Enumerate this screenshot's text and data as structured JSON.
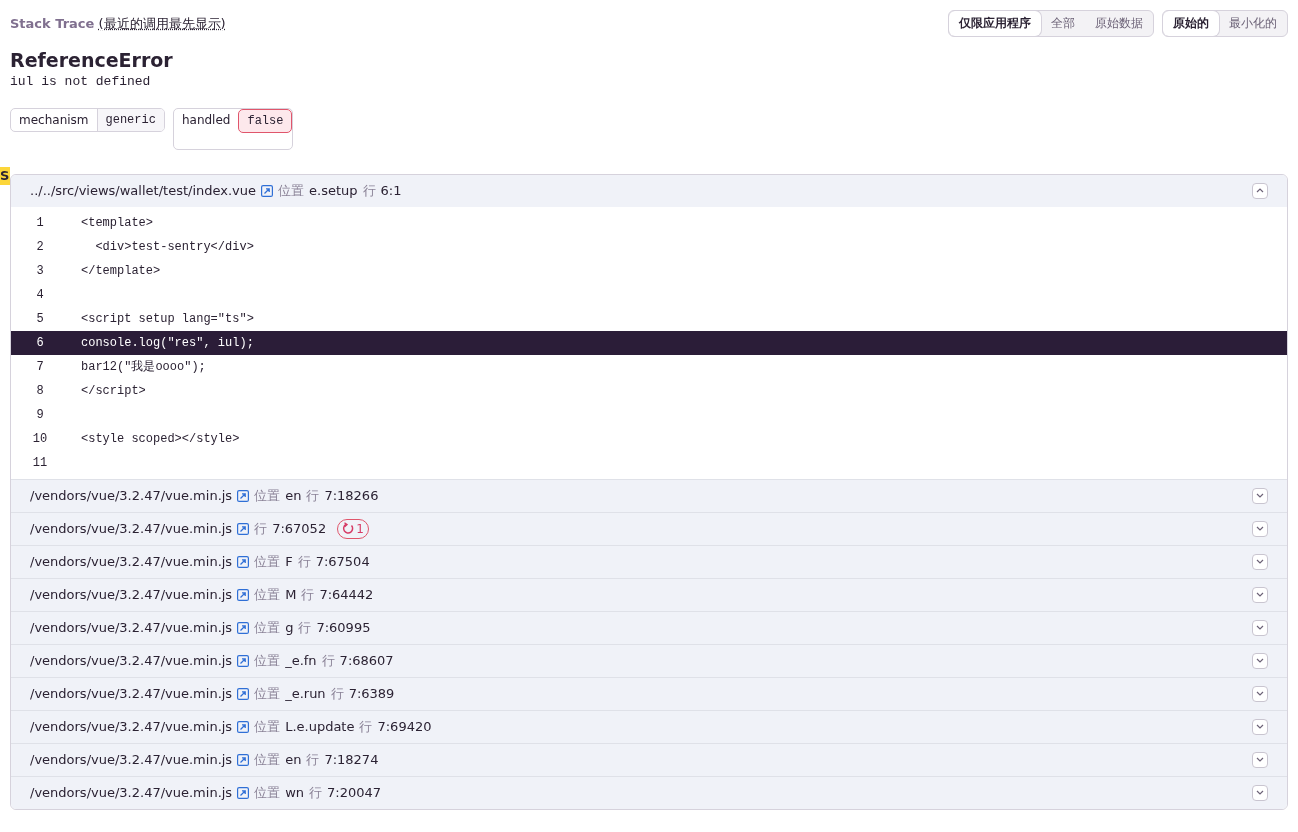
{
  "header": {
    "title": "Stack Trace",
    "subtitle": "(最近的调用最先显示)"
  },
  "filters": [
    [
      {
        "label": "仅限应用程序",
        "selected": true
      },
      {
        "label": "全部",
        "selected": false
      },
      {
        "label": "原始数据",
        "selected": false
      }
    ],
    [
      {
        "label": "原始的",
        "selected": true
      },
      {
        "label": "最小化的",
        "selected": false
      }
    ]
  ],
  "error": {
    "type": "ReferenceError",
    "message": "iul is not defined"
  },
  "tags": [
    {
      "key": "mechanism",
      "value": "generic",
      "alert": false
    },
    {
      "key": "handled",
      "value": "false",
      "alert": true
    }
  ],
  "side_marker": "S",
  "frames": [
    {
      "file": "../../src/views/wallet/test/index.vue",
      "at_label": "位置",
      "function": "e.setup",
      "line_label": "行",
      "line": "6:1",
      "expanded": true,
      "code": [
        {
          "number": "1",
          "text": "<template>",
          "selected": false
        },
        {
          "number": "2",
          "text": "  <div>test-sentry</div>",
          "selected": false
        },
        {
          "number": "3",
          "text": "</template>",
          "selected": false
        },
        {
          "number": "4",
          "selected": false
        },
        {
          "number": "5",
          "text": "<script setup lang=\"ts\">",
          "selected": false
        },
        {
          "number": "6",
          "text": "console.log(\"res\", iul);",
          "selected": true
        },
        {
          "number": "7",
          "text": "bar12(\"我是oooo\");",
          "selected": false
        },
        {
          "number": "8",
          "text": "</script>",
          "selected": false
        },
        {
          "number": "9",
          "selected": false
        },
        {
          "number": "10",
          "text": "<style scoped></style>",
          "selected": false
        },
        {
          "number": "11",
          "selected": false
        }
      ]
    },
    {
      "file": "/vendors/vue/3.2.47/vue.min.js",
      "at_label": "位置",
      "function": "en",
      "line_label": "行",
      "line": "7:18266",
      "expanded": false
    },
    {
      "file": "/vendors/vue/3.2.47/vue.min.js",
      "line_label": "行",
      "line": "7:67052",
      "repeats": "1",
      "expanded": false
    },
    {
      "file": "/vendors/vue/3.2.47/vue.min.js",
      "at_label": "位置",
      "function": "F",
      "line_label": "行",
      "line": "7:67504",
      "expanded": false
    },
    {
      "file": "/vendors/vue/3.2.47/vue.min.js",
      "at_label": "位置",
      "function": "M",
      "line_label": "行",
      "line": "7:64442",
      "expanded": false
    },
    {
      "file": "/vendors/vue/3.2.47/vue.min.js",
      "at_label": "位置",
      "function": "g",
      "line_label": "行",
      "line": "7:60995",
      "expanded": false
    },
    {
      "file": "/vendors/vue/3.2.47/vue.min.js",
      "at_label": "位置",
      "function": "_e.fn",
      "line_label": "行",
      "line": "7:68607",
      "expanded": false
    },
    {
      "file": "/vendors/vue/3.2.47/vue.min.js",
      "at_label": "位置",
      "function": "_e.run",
      "line_label": "行",
      "line": "7:6389",
      "expanded": false
    },
    {
      "file": "/vendors/vue/3.2.47/vue.min.js",
      "at_label": "位置",
      "function": "L.e.update",
      "line_label": "行",
      "line": "7:69420",
      "expanded": false
    },
    {
      "file": "/vendors/vue/3.2.47/vue.min.js",
      "at_label": "位置",
      "function": "en",
      "line_label": "行",
      "line": "7:18274",
      "expanded": false
    },
    {
      "file": "/vendors/vue/3.2.47/vue.min.js",
      "at_label": "位置",
      "function": "wn",
      "line_label": "行",
      "line": "7:20047",
      "expanded": false
    }
  ]
}
